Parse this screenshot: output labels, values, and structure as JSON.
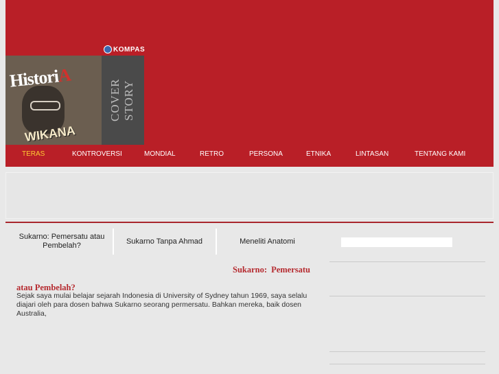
{
  "header": {
    "kompas_logo": "KOMPAS",
    "cover": {
      "magazine_title": "HistoriA",
      "cover_name": "WIKANA",
      "section_label": "COVER STORY"
    }
  },
  "nav": {
    "items": [
      {
        "label": "TERAS",
        "active": true
      },
      {
        "label": "KONTROVERSI",
        "active": false
      },
      {
        "label": "MONDIAL",
        "active": false
      },
      {
        "label": "RETRO",
        "active": false
      },
      {
        "label": "PERSONA",
        "active": false
      },
      {
        "label": "ETNIKA",
        "active": false
      },
      {
        "label": "LINTASAN",
        "active": false
      },
      {
        "label": "TENTANG KAMI",
        "active": false
      }
    ]
  },
  "tabs": [
    {
      "label": "Sukarno: Pemersatu atau Pembelah?"
    },
    {
      "label": "Sukarno Tanpa Ahmad"
    },
    {
      "label": "Meneliti Anatomi"
    }
  ],
  "search": {
    "placeholder": "",
    "value": ""
  },
  "article": {
    "title": "Sukarno: Pemersatu atau Pembelah?",
    "body": "Sejak saya mulai belajar sejarah Indonesia di University of Sydney tahun 1969, saya selalu diajari oleh para dosen bahwa Sukarno seorang permersatu. Bahkan mereka, baik dosen Australia,"
  },
  "colors": {
    "brand_red": "#b91f27",
    "active_nav": "#ffcc33",
    "title_red": "#b52a2f",
    "background": "#e8e8e8"
  }
}
